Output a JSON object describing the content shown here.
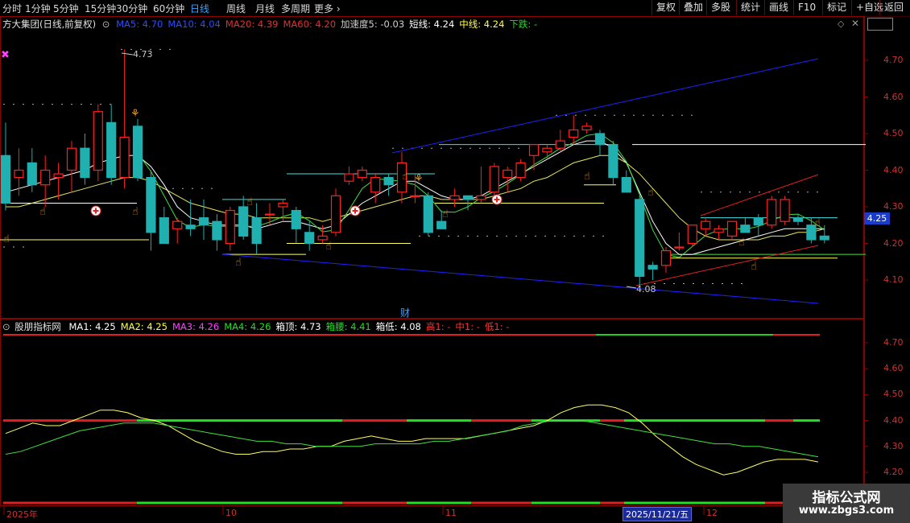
{
  "toolbar": {
    "timeframes": [
      "分时",
      "1分钟",
      "5分钟",
      "15分钟",
      "30分钟",
      "60分钟",
      "日线",
      "周线",
      "月线",
      "多周期",
      "更多"
    ],
    "active_timeframe": "日线",
    "right_buttons": [
      "复权",
      "叠加",
      "多股",
      "统计",
      "画线",
      "F10",
      "标记",
      "+自选",
      "返回"
    ]
  },
  "main_legend": {
    "title": "方大集团(日线,前复权)",
    "items": [
      {
        "text": "MA5: 4.70",
        "color": "#2b4cff"
      },
      {
        "text": "MA10: 4.04",
        "color": "#2b4cff"
      },
      {
        "text": "MA20: 4.39",
        "color": "#e03030"
      },
      {
        "text": "MA60: 4.20",
        "color": "#e03030"
      },
      {
        "text": "加速度5: -0.03",
        "color": "#d0d0d0"
      },
      {
        "text": "短线: 4.24",
        "color": "#ffffff"
      },
      {
        "text": "中线: 4.24",
        "color": "#ffff40"
      },
      {
        "text": "下跌: -",
        "color": "#20e020"
      }
    ]
  },
  "sub_legend": {
    "title": "股朋指标网",
    "items": [
      {
        "text": "MA1: 4.25",
        "color": "#ffffff"
      },
      {
        "text": "MA2: 4.25",
        "color": "#ffff40"
      },
      {
        "text": "MA3: 4.26",
        "color": "#ff40ff"
      },
      {
        "text": "MA4: 4.26",
        "color": "#20e020"
      },
      {
        "text": "箱顶: 4.73",
        "color": "#ffffff"
      },
      {
        "text": "箱腰: 4.41",
        "color": "#20e020"
      },
      {
        "text": "箱低: 4.08",
        "color": "#ffffff"
      },
      {
        "text": "高1: -",
        "color": "#ff3030"
      },
      {
        "text": "中1: -",
        "color": "#ff3030"
      },
      {
        "text": "低1: -",
        "color": "#ff3030"
      }
    ]
  },
  "main_axis": [
    "4.70",
    "4.60",
    "4.50",
    "4.40",
    "4.30",
    "4.20",
    "4.10"
  ],
  "sub_axis": [
    "4.70",
    "4.60",
    "4.50",
    "4.40",
    "4.30",
    "4.20"
  ],
  "current_price": "4.25",
  "annotations": {
    "high": "4.73",
    "low": "4.08",
    "cai": "财"
  },
  "x_labels": [
    {
      "text": "2025年",
      "x": 8
    },
    {
      "text": "10",
      "x": 280
    },
    {
      "text": "11",
      "x": 553
    },
    {
      "text": "12",
      "x": 877
    }
  ],
  "cursor_date": "2025/11/21/五",
  "watermark": {
    "line1": "指标公式网",
    "line2": "www.zbgs3.com"
  },
  "colors": {
    "up": "#ff2020",
    "down": "#20b0b0",
    "ma_short": "#ffffff",
    "ma_mid": "#ffff40",
    "ma_green": "#40e040",
    "trend": "#2020ff"
  },
  "chart_data": {
    "type": "candlestick",
    "ylim": [
      4.03,
      4.78
    ],
    "candles": [
      {
        "o": 4.44,
        "h": 4.53,
        "l": 4.29,
        "c": 4.31
      },
      {
        "o": 4.38,
        "h": 4.46,
        "l": 4.33,
        "c": 4.4
      },
      {
        "o": 4.42,
        "h": 4.46,
        "l": 4.34,
        "c": 4.36
      },
      {
        "o": 4.36,
        "h": 4.44,
        "l": 4.3,
        "c": 4.4
      },
      {
        "o": 4.38,
        "h": 4.42,
        "l": 4.32,
        "c": 4.39
      },
      {
        "o": 4.4,
        "h": 4.48,
        "l": 4.34,
        "c": 4.46
      },
      {
        "o": 4.46,
        "h": 4.5,
        "l": 4.36,
        "c": 4.38
      },
      {
        "o": 4.4,
        "h": 4.58,
        "l": 4.37,
        "c": 4.56
      },
      {
        "o": 4.53,
        "h": 4.58,
        "l": 4.36,
        "c": 4.38
      },
      {
        "o": 4.38,
        "h": 4.73,
        "l": 4.35,
        "c": 4.49
      },
      {
        "o": 4.52,
        "h": 4.54,
        "l": 4.37,
        "c": 4.38
      },
      {
        "o": 4.38,
        "h": 4.4,
        "l": 4.18,
        "c": 4.23
      },
      {
        "o": 4.27,
        "h": 4.3,
        "l": 4.2,
        "c": 4.2
      },
      {
        "o": 4.24,
        "h": 4.27,
        "l": 4.2,
        "c": 4.26
      },
      {
        "o": 4.25,
        "h": 4.32,
        "l": 4.22,
        "c": 4.24
      },
      {
        "o": 4.27,
        "h": 4.32,
        "l": 4.21,
        "c": 4.25
      },
      {
        "o": 4.26,
        "h": 4.28,
        "l": 4.18,
        "c": 4.21
      },
      {
        "o": 4.2,
        "h": 4.3,
        "l": 4.18,
        "c": 4.29
      },
      {
        "o": 4.3,
        "h": 4.33,
        "l": 4.21,
        "c": 4.22
      },
      {
        "o": 4.27,
        "h": 4.31,
        "l": 4.17,
        "c": 4.2
      },
      {
        "o": 4.28,
        "h": 4.31,
        "l": 4.25,
        "c": 4.28
      },
      {
        "o": 4.3,
        "h": 4.32,
        "l": 4.26,
        "c": 4.31
      },
      {
        "o": 4.29,
        "h": 4.3,
        "l": 4.2,
        "c": 4.24
      },
      {
        "o": 4.23,
        "h": 4.26,
        "l": 4.18,
        "c": 4.2
      },
      {
        "o": 4.21,
        "h": 4.25,
        "l": 4.2,
        "c": 4.22
      },
      {
        "o": 4.23,
        "h": 4.35,
        "l": 4.22,
        "c": 4.33
      },
      {
        "o": 4.37,
        "h": 4.41,
        "l": 4.36,
        "c": 4.39
      },
      {
        "o": 4.38,
        "h": 4.41,
        "l": 4.37,
        "c": 4.4
      },
      {
        "o": 4.34,
        "h": 4.39,
        "l": 4.31,
        "c": 4.38
      },
      {
        "o": 4.38,
        "h": 4.39,
        "l": 4.33,
        "c": 4.36
      },
      {
        "o": 4.34,
        "h": 4.45,
        "l": 4.31,
        "c": 4.42
      },
      {
        "o": 4.33,
        "h": 4.39,
        "l": 4.31,
        "c": 4.33
      },
      {
        "o": 4.33,
        "h": 4.34,
        "l": 4.22,
        "c": 4.23
      },
      {
        "o": 4.26,
        "h": 4.29,
        "l": 4.24,
        "c": 4.24
      },
      {
        "o": 4.32,
        "h": 4.35,
        "l": 4.3,
        "c": 4.33
      },
      {
        "o": 4.33,
        "h": 4.33,
        "l": 4.29,
        "c": 4.32
      },
      {
        "o": 4.32,
        "h": 4.41,
        "l": 4.31,
        "c": 4.33
      },
      {
        "o": 4.34,
        "h": 4.42,
        "l": 4.32,
        "c": 4.41
      },
      {
        "o": 4.38,
        "h": 4.41,
        "l": 4.34,
        "c": 4.4
      },
      {
        "o": 4.38,
        "h": 4.43,
        "l": 4.37,
        "c": 4.42
      },
      {
        "o": 4.44,
        "h": 4.47,
        "l": 4.4,
        "c": 4.47
      },
      {
        "o": 4.45,
        "h": 4.47,
        "l": 4.43,
        "c": 4.46
      },
      {
        "o": 4.46,
        "h": 4.51,
        "l": 4.45,
        "c": 4.48
      },
      {
        "o": 4.49,
        "h": 4.55,
        "l": 4.47,
        "c": 4.51
      },
      {
        "o": 4.51,
        "h": 4.53,
        "l": 4.5,
        "c": 4.52
      },
      {
        "o": 4.5,
        "h": 4.51,
        "l": 4.44,
        "c": 4.47
      },
      {
        "o": 4.47,
        "h": 4.48,
        "l": 4.36,
        "c": 4.38
      },
      {
        "o": 4.38,
        "h": 4.4,
        "l": 4.34,
        "c": 4.34
      },
      {
        "o": 4.32,
        "h": 4.33,
        "l": 4.08,
        "c": 4.11
      },
      {
        "o": 4.14,
        "h": 4.15,
        "l": 4.1,
        "c": 4.13
      },
      {
        "o": 4.14,
        "h": 4.19,
        "l": 4.12,
        "c": 4.18
      },
      {
        "o": 4.19,
        "h": 4.23,
        "l": 4.18,
        "c": 4.19
      },
      {
        "o": 4.2,
        "h": 4.25,
        "l": 4.19,
        "c": 4.25
      },
      {
        "o": 4.24,
        "h": 4.27,
        "l": 4.22,
        "c": 4.26
      },
      {
        "o": 4.23,
        "h": 4.25,
        "l": 4.21,
        "c": 4.24
      },
      {
        "o": 4.22,
        "h": 4.26,
        "l": 4.21,
        "c": 4.26
      },
      {
        "o": 4.25,
        "h": 4.27,
        "l": 4.23,
        "c": 4.23
      },
      {
        "o": 4.27,
        "h": 4.28,
        "l": 4.22,
        "c": 4.25
      },
      {
        "o": 4.25,
        "h": 4.33,
        "l": 4.24,
        "c": 4.32
      },
      {
        "o": 4.26,
        "h": 4.33,
        "l": 4.25,
        "c": 4.32
      },
      {
        "o": 4.27,
        "h": 4.28,
        "l": 4.25,
        "c": 4.26
      },
      {
        "o": 4.25,
        "h": 4.27,
        "l": 4.2,
        "c": 4.21
      },
      {
        "o": 4.22,
        "h": 4.25,
        "l": 4.2,
        "c": 4.21
      }
    ],
    "ma_white": [
      4.34,
      4.35,
      4.36,
      4.37,
      4.38,
      4.39,
      4.4,
      4.42,
      4.43,
      4.44,
      4.44,
      4.41,
      4.36,
      4.3,
      4.27,
      4.26,
      4.25,
      4.25,
      4.25,
      4.24,
      4.25,
      4.26,
      4.26,
      4.25,
      4.24,
      4.25,
      4.28,
      4.31,
      4.33,
      4.35,
      4.37,
      4.37,
      4.35,
      4.33,
      4.32,
      4.32,
      4.33,
      4.35,
      4.37,
      4.39,
      4.41,
      4.43,
      4.45,
      4.47,
      4.48,
      4.48,
      4.46,
      4.42,
      4.34,
      4.26,
      4.2,
      4.17,
      4.17,
      4.18,
      4.19,
      4.2,
      4.21,
      4.22,
      4.23,
      4.24,
      4.24,
      4.24,
      4.24
    ],
    "ma_yellow": [
      4.3,
      4.3,
      4.31,
      4.32,
      4.33,
      4.34,
      4.35,
      4.36,
      4.37,
      4.38,
      4.38,
      4.37,
      4.35,
      4.33,
      4.31,
      4.3,
      4.29,
      4.28,
      4.28,
      4.27,
      4.27,
      4.27,
      4.27,
      4.27,
      4.26,
      4.27,
      4.28,
      4.29,
      4.3,
      4.31,
      4.32,
      4.33,
      4.33,
      4.32,
      4.32,
      4.32,
      4.32,
      4.33,
      4.34,
      4.35,
      4.37,
      4.38,
      4.4,
      4.42,
      4.43,
      4.44,
      4.44,
      4.42,
      4.39,
      4.35,
      4.31,
      4.27,
      4.24,
      4.22,
      4.21,
      4.21,
      4.21,
      4.21,
      4.22,
      4.22,
      4.23,
      4.23,
      4.24
    ],
    "sub_ylim": [
      4.17,
      4.78
    ],
    "sub_white": [
      4.35,
      4.37,
      4.39,
      4.38,
      4.38,
      4.4,
      4.42,
      4.44,
      4.44,
      4.43,
      4.41,
      4.4,
      4.38,
      4.35,
      4.32,
      4.3,
      4.28,
      4.27,
      4.27,
      4.28,
      4.28,
      4.29,
      4.29,
      4.3,
      4.3,
      4.32,
      4.33,
      4.34,
      4.33,
      4.32,
      4.32,
      4.33,
      4.33,
      4.33,
      4.33,
      4.34,
      4.35,
      4.36,
      4.37,
      4.38,
      4.4,
      4.43,
      4.45,
      4.46,
      4.46,
      4.45,
      4.43,
      4.39,
      4.34,
      4.3,
      4.26,
      4.23,
      4.21,
      4.19,
      4.2,
      4.22,
      4.24,
      4.25,
      4.25,
      4.25,
      4.24
    ],
    "sub_green": [
      4.27,
      4.28,
      4.3,
      4.32,
      4.34,
      4.36,
      4.37,
      4.38,
      4.39,
      4.39,
      4.39,
      4.38,
      4.37,
      4.36,
      4.35,
      4.34,
      4.33,
      4.32,
      4.32,
      4.31,
      4.31,
      4.3,
      4.3,
      4.3,
      4.3,
      4.31,
      4.31,
      4.31,
      4.31,
      4.32,
      4.32,
      4.33,
      4.34,
      4.35,
      4.36,
      4.38,
      4.39,
      4.4,
      4.4,
      4.4,
      4.39,
      4.38,
      4.37,
      4.36,
      4.35,
      4.34,
      4.33,
      4.32,
      4.31,
      4.31,
      4.3,
      4.3,
      4.29,
      4.28,
      4.27,
      4.26
    ],
    "box_top": "4.73",
    "box_mid": "4.41",
    "box_low": "4.08",
    "level_line": "4.40"
  }
}
